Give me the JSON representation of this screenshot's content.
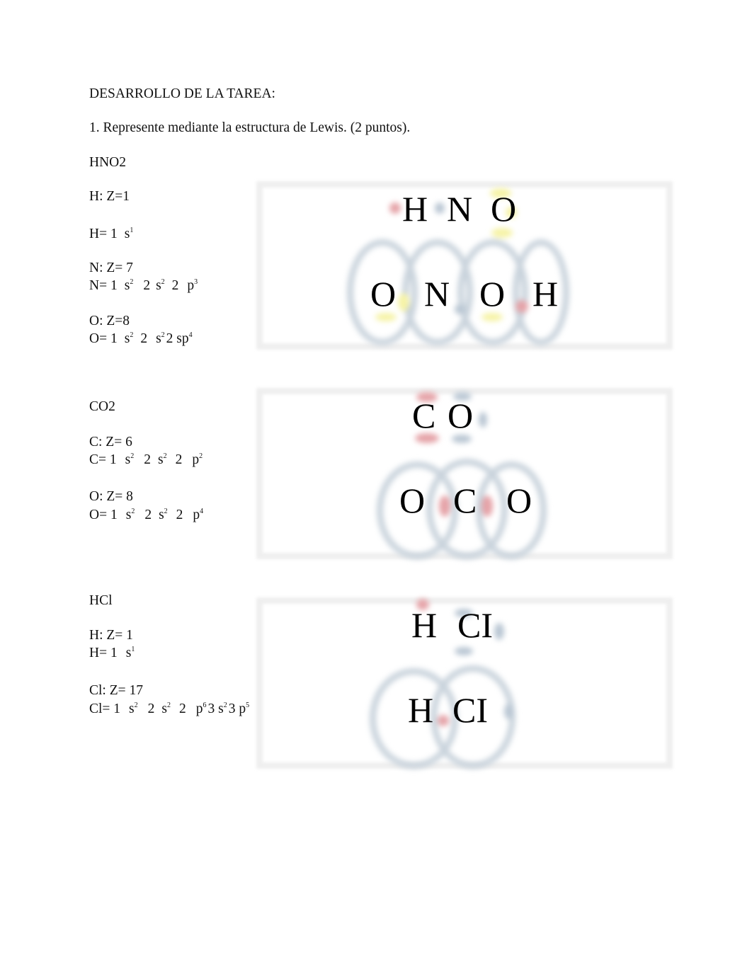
{
  "heading": "DESARROLLO DE LA TAREA:",
  "question": "1. Represente mediante la estructura de Lewis. (2 puntos).",
  "sections": [
    {
      "formula": "HNO2",
      "lines": [
        {
          "text": "H: Z=1"
        },
        {
          "config": [
            [
              "H= 1",
              ""
            ],
            [
              "s",
              "1"
            ]
          ]
        },
        {
          "text": "N: Z= 7"
        },
        {
          "config": [
            [
              "N= 1",
              ""
            ],
            [
              "s",
              "2"
            ],
            [
              "2",
              ""
            ],
            [
              "s",
              "2"
            ],
            [
              "2",
              ""
            ],
            [
              "p",
              "3"
            ]
          ]
        },
        {
          "text": "O: Z=8"
        },
        {
          "config": [
            [
              "O= 1",
              ""
            ],
            [
              "s",
              "2"
            ],
            [
              "2",
              ""
            ],
            [
              "s",
              "2"
            ],
            [
              "2 sp",
              "4"
            ]
          ]
        }
      ],
      "diagram": {
        "top_labels": [
          "H",
          "N",
          "O"
        ],
        "bottom_labels": [
          "O",
          "N",
          "O",
          "H"
        ]
      }
    },
    {
      "formula": "CO2",
      "lines": [
        {
          "text": "C: Z= 6"
        },
        {
          "config": [
            [
              "C= 1",
              ""
            ],
            [
              "s",
              "2"
            ],
            [
              "2",
              ""
            ],
            [
              "s",
              "2"
            ],
            [
              "2",
              ""
            ],
            [
              "p",
              "2"
            ]
          ]
        },
        {
          "text": "O: Z= 8"
        },
        {
          "config": [
            [
              "O= 1",
              ""
            ],
            [
              "s",
              "2"
            ],
            [
              "2",
              ""
            ],
            [
              "s",
              "2"
            ],
            [
              "2",
              ""
            ],
            [
              "p",
              "4"
            ]
          ]
        }
      ],
      "diagram": {
        "top_labels": [
          "C",
          "O"
        ],
        "bottom_labels": [
          "O",
          "C",
          "O"
        ]
      }
    },
    {
      "formula": "HCl",
      "lines": [
        {
          "text": "H: Z= 1"
        },
        {
          "config": [
            [
              "H= 1",
              ""
            ],
            [
              "s",
              "1"
            ]
          ]
        },
        {
          "text": "Cl: Z= 17"
        },
        {
          "config": [
            [
              "Cl= 1",
              ""
            ],
            [
              "s",
              "2"
            ],
            [
              "2",
              ""
            ],
            [
              "s",
              "2"
            ],
            [
              "2",
              ""
            ],
            [
              "p",
              "6"
            ],
            [
              "3 s",
              "2"
            ],
            [
              "3 p",
              "5"
            ]
          ]
        }
      ],
      "diagram": {
        "top_labels": [
          "H",
          "CI"
        ],
        "bottom_labels": [
          "H",
          "CI"
        ]
      }
    }
  ]
}
